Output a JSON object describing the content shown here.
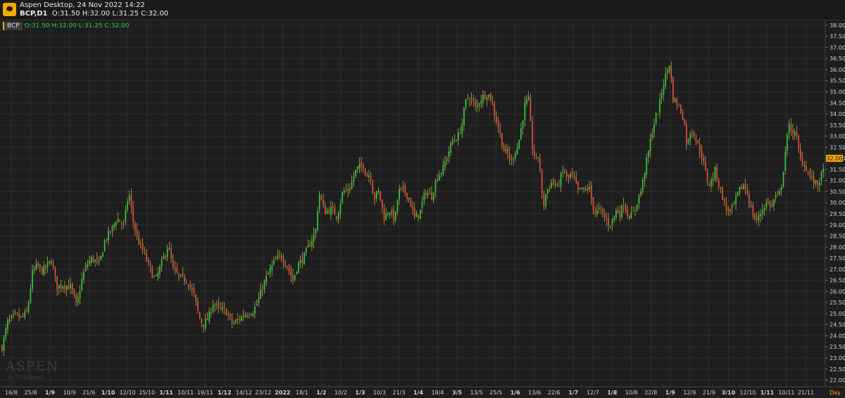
{
  "window": {
    "title": "Aspen Desktop, 24 Nov 2022 14:22"
  },
  "header": {
    "symbol_tf": "BCP,D1",
    "ohlc": "O:31.50 H:32.00 L:31.25 C:32.00"
  },
  "legend": {
    "symbol": "BCP",
    "values": "O:31.50 H:32.00 L:31.25 C:32.00"
  },
  "watermark": {
    "text": "ASPEN",
    "sub": "by ThaiQuest"
  },
  "colors": {
    "up": "#2ecc40",
    "down": "#e74c3c",
    "wick_up": "#f2c94c",
    "wick_down": "#f2c94c",
    "grid": "#2c2c2c",
    "price_tag": "#f2a900"
  },
  "chart_data": {
    "type": "candlestick",
    "symbol": "BCP",
    "timeframe": "D1",
    "y_ticks": [
      "22.00",
      "22.50",
      "23.00",
      "23.50",
      "24.00",
      "24.50",
      "25.00",
      "25.50",
      "26.00",
      "26.50",
      "27.00",
      "27.50",
      "28.00",
      "28.50",
      "29.00",
      "29.50",
      "30.00",
      "30.50",
      "31.00",
      "31.50",
      "32.00",
      "32.50",
      "33.00",
      "33.50",
      "34.00",
      "34.50",
      "35.00",
      "35.50",
      "36.00",
      "36.50",
      "37.00",
      "37.50",
      "38.00"
    ],
    "ylim": [
      21.7,
      38.25
    ],
    "x_ticks": [
      "16/8",
      "25/8",
      "1/9",
      "10/9",
      "21/9",
      "1/10",
      "12/10",
      "25/10",
      "1/11",
      "10/11",
      "19/11",
      "1/12",
      "14/12",
      "23/12",
      "2022",
      "18/1",
      "1/2",
      "10/2",
      "1/3",
      "10/3",
      "21/3",
      "1/4",
      "18/4",
      "3/5",
      "13/5",
      "25/5",
      "1/6",
      "13/6",
      "22/6",
      "1/7",
      "12/7",
      "1/8",
      "10/8",
      "22/8",
      "1/9",
      "12/9",
      "21/9",
      "3/10",
      "12/10",
      "1/11",
      "10/11",
      "21/11"
    ],
    "x_tick_bold": [
      "1/9",
      "1/10",
      "1/11",
      "1/12",
      "2022",
      "1/2",
      "1/3",
      "1/4",
      "3/5",
      "1/6",
      "1/7",
      "1/8",
      "1/9",
      "3/10",
      "1/11"
    ],
    "period_label": "Day",
    "last_price": "32.00",
    "close_path": [
      [
        0,
        23.2
      ],
      [
        10,
        24.6
      ],
      [
        20,
        24.9
      ],
      [
        30,
        24.8
      ],
      [
        38,
        25.1
      ],
      [
        45,
        26.8
      ],
      [
        52,
        27.2
      ],
      [
        58,
        26.9
      ],
      [
        65,
        27.1
      ],
      [
        72,
        27.4
      ],
      [
        80,
        26.2
      ],
      [
        88,
        26.3
      ],
      [
        100,
        26.2
      ],
      [
        108,
        25.3
      ],
      [
        115,
        26.5
      ],
      [
        122,
        27.2
      ],
      [
        130,
        27.5
      ],
      [
        140,
        27.2
      ],
      [
        148,
        28.3
      ],
      [
        158,
        28.8
      ],
      [
        165,
        29.3
      ],
      [
        175,
        29.0
      ],
      [
        182,
        30.5
      ],
      [
        188,
        29.2
      ],
      [
        195,
        28.3
      ],
      [
        205,
        27.6
      ],
      [
        215,
        26.8
      ],
      [
        220,
        26.5
      ],
      [
        228,
        27.2
      ],
      [
        238,
        28.1
      ],
      [
        245,
        27.0
      ],
      [
        255,
        26.6
      ],
      [
        265,
        26.5
      ],
      [
        275,
        25.8
      ],
      [
        282,
        24.8
      ],
      [
        288,
        24.5
      ],
      [
        295,
        24.8
      ],
      [
        302,
        25.5
      ],
      [
        310,
        25.2
      ],
      [
        320,
        25.1
      ],
      [
        330,
        24.5
      ],
      [
        340,
        24.8
      ],
      [
        348,
        25.0
      ],
      [
        358,
        25.1
      ],
      [
        365,
        25.5
      ],
      [
        372,
        26.2
      ],
      [
        380,
        26.8
      ],
      [
        390,
        27.4
      ],
      [
        398,
        27.6
      ],
      [
        405,
        27.3
      ],
      [
        415,
        26.5
      ],
      [
        422,
        27.2
      ],
      [
        430,
        27.5
      ],
      [
        440,
        28.2
      ],
      [
        448,
        28.8
      ],
      [
        452,
        30.5
      ],
      [
        460,
        29.6
      ],
      [
        470,
        29.7
      ],
      [
        478,
        29.4
      ],
      [
        486,
        30.5
      ],
      [
        495,
        30.6
      ],
      [
        505,
        31.5
      ],
      [
        515,
        31.7
      ],
      [
        520,
        31.2
      ],
      [
        525,
        31.3
      ],
      [
        530,
        30.2
      ],
      [
        537,
        30.5
      ],
      [
        545,
        29.3
      ],
      [
        552,
        29.7
      ],
      [
        560,
        29.2
      ],
      [
        565,
        30.5
      ],
      [
        572,
        30.6
      ],
      [
        580,
        30.2
      ],
      [
        588,
        29.3
      ],
      [
        595,
        29.5
      ],
      [
        603,
        30.5
      ],
      [
        612,
        30.3
      ],
      [
        620,
        31.2
      ],
      [
        628,
        31.5
      ],
      [
        635,
        32.2
      ],
      [
        642,
        32.8
      ],
      [
        650,
        33.0
      ],
      [
        655,
        33.5
      ],
      [
        660,
        34.5
      ],
      [
        665,
        34.8
      ],
      [
        670,
        34.6
      ],
      [
        675,
        34.2
      ],
      [
        680,
        34.6
      ],
      [
        685,
        34.8
      ],
      [
        690,
        34.9
      ],
      [
        695,
        34.8
      ],
      [
        700,
        34.2
      ],
      [
        705,
        33.6
      ],
      [
        710,
        33.0
      ],
      [
        715,
        32.3
      ],
      [
        720,
        32.2
      ],
      [
        725,
        31.8
      ],
      [
        730,
        32.3
      ],
      [
        735,
        32.6
      ],
      [
        740,
        33.5
      ],
      [
        745,
        34.5
      ],
      [
        750,
        34.6
      ],
      [
        755,
        32.5
      ],
      [
        760,
        31.9
      ],
      [
        765,
        32.1
      ],
      [
        770,
        29.7
      ],
      [
        775,
        30.5
      ],
      [
        780,
        30.8
      ],
      [
        785,
        31.0
      ],
      [
        790,
        30.6
      ],
      [
        795,
        31.1
      ],
      [
        800,
        31.5
      ],
      [
        805,
        31.0
      ],
      [
        810,
        31.3
      ],
      [
        815,
        31.0
      ],
      [
        820,
        30.5
      ],
      [
        825,
        30.6
      ],
      [
        830,
        30.5
      ],
      [
        835,
        30.8
      ],
      [
        840,
        30.0
      ],
      [
        845,
        29.5
      ],
      [
        850,
        29.7
      ],
      [
        855,
        29.5
      ],
      [
        860,
        29.2
      ],
      [
        865,
        29.0
      ],
      [
        870,
        29.3
      ],
      [
        875,
        29.7
      ],
      [
        880,
        29.5
      ],
      [
        885,
        30.0
      ],
      [
        890,
        29.5
      ],
      [
        895,
        29.4
      ],
      [
        900,
        29.6
      ],
      [
        905,
        30.2
      ],
      [
        910,
        30.6
      ],
      [
        915,
        31.5
      ],
      [
        920,
        32.3
      ],
      [
        925,
        33.2
      ],
      [
        930,
        33.8
      ],
      [
        935,
        34.3
      ],
      [
        940,
        35.2
      ],
      [
        945,
        35.8
      ],
      [
        950,
        36.3
      ],
      [
        955,
        34.7
      ],
      [
        960,
        34.5
      ],
      [
        965,
        34.2
      ],
      [
        970,
        33.8
      ],
      [
        975,
        32.5
      ],
      [
        980,
        33.3
      ],
      [
        985,
        33.1
      ],
      [
        990,
        32.6
      ],
      [
        995,
        32.2
      ],
      [
        1000,
        31.5
      ],
      [
        1005,
        30.8
      ],
      [
        1010,
        31.0
      ],
      [
        1015,
        31.5
      ],
      [
        1020,
        30.8
      ],
      [
        1025,
        30.3
      ],
      [
        1030,
        29.7
      ],
      [
        1035,
        29.6
      ],
      [
        1040,
        29.8
      ],
      [
        1045,
        30.2
      ],
      [
        1050,
        30.6
      ],
      [
        1055,
        30.8
      ],
      [
        1060,
        30.5
      ],
      [
        1065,
        29.8
      ],
      [
        1070,
        29.3
      ],
      [
        1075,
        29.2
      ],
      [
        1080,
        29.6
      ],
      [
        1085,
        29.9
      ],
      [
        1090,
        30.0
      ],
      [
        1095,
        29.8
      ],
      [
        1100,
        30.3
      ],
      [
        1105,
        30.2
      ],
      [
        1110,
        31.0
      ],
      [
        1115,
        32.5
      ],
      [
        1120,
        33.5
      ],
      [
        1125,
        33.2
      ],
      [
        1130,
        33.0
      ],
      [
        1135,
        32.0
      ],
      [
        1140,
        31.8
      ],
      [
        1145,
        31.5
      ],
      [
        1150,
        31.2
      ],
      [
        1155,
        30.9
      ],
      [
        1160,
        30.8
      ],
      [
        1165,
        31.2
      ],
      [
        1170,
        31.5
      ],
      [
        1172,
        32.0
      ]
    ]
  }
}
